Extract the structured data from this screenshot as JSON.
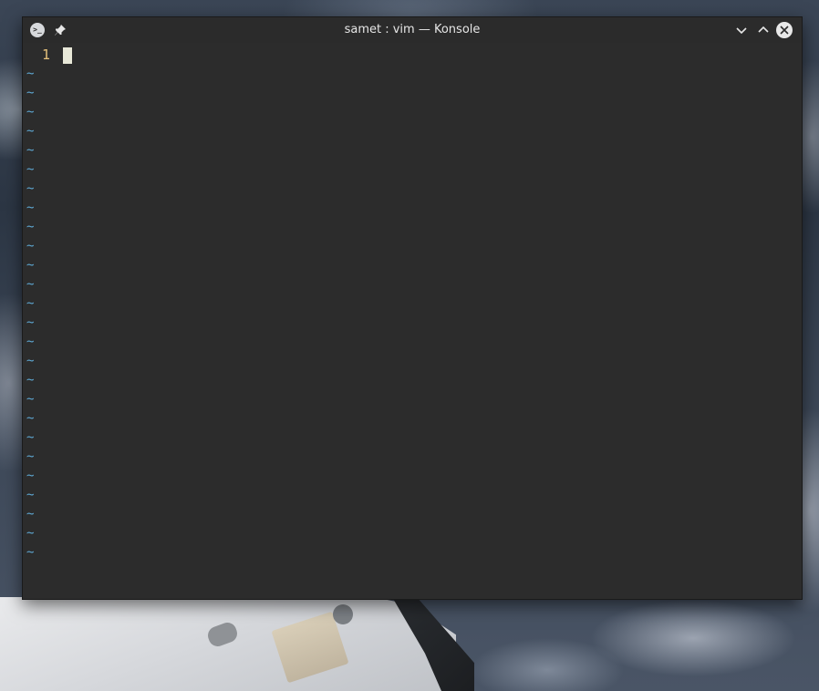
{
  "window": {
    "title": "samet : vim — Konsole",
    "app_icon_glyph": ">_"
  },
  "editor": {
    "line_numbers": [
      "1"
    ],
    "empty_line_marker": "~",
    "empty_line_count": 26,
    "colors": {
      "line_number": "#e5c07b",
      "empty_line_marker": "#5fa8d3",
      "background": "#2c2c2c"
    }
  },
  "icons": {
    "app": "terminal-icon",
    "pin": "pin-icon",
    "minimize": "chevron-down-icon",
    "maximize": "chevron-up-icon",
    "close": "close-icon"
  }
}
